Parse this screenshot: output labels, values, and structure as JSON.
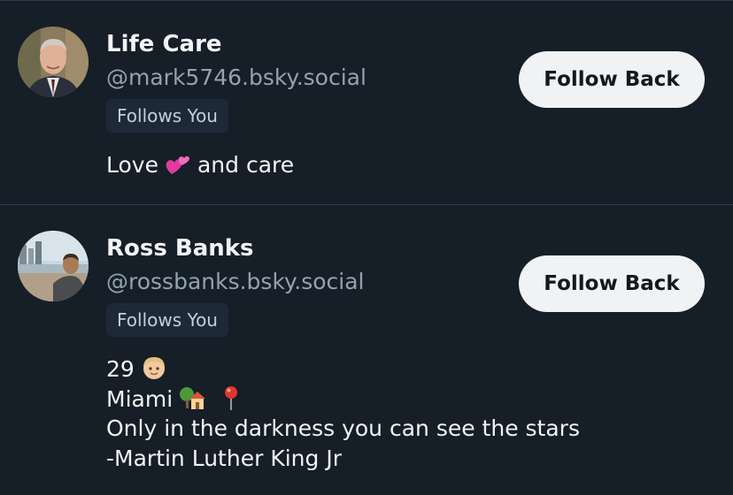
{
  "profiles": [
    {
      "name": "Life Care",
      "handle": "@mark5746.bsky.social",
      "badge": "Follows You",
      "button": "Follow Back",
      "bio": {
        "before": "Love",
        "emoji": "two-hearts",
        "after": "and care"
      }
    },
    {
      "name": "Ross Banks",
      "handle": "@rossbanks.bsky.social",
      "badge": "Follows You",
      "button": "Follow Back",
      "bio": {
        "line1": "29",
        "line1_emoji": "boy-light-skin-tone",
        "line2": "Miami",
        "line2_emojis": [
          "house-with-garden",
          "round-pushpin"
        ],
        "line3": "Only in the darkness you can see the stars",
        "line4": "-Martin Luther King Jr"
      }
    }
  ],
  "colors": {
    "background": "#161e27",
    "divider": "#2e3a47",
    "handle": "#93a2b3",
    "badge_bg": "#1e2937",
    "button_bg": "#f0f2f4",
    "button_text": "#14181d"
  }
}
